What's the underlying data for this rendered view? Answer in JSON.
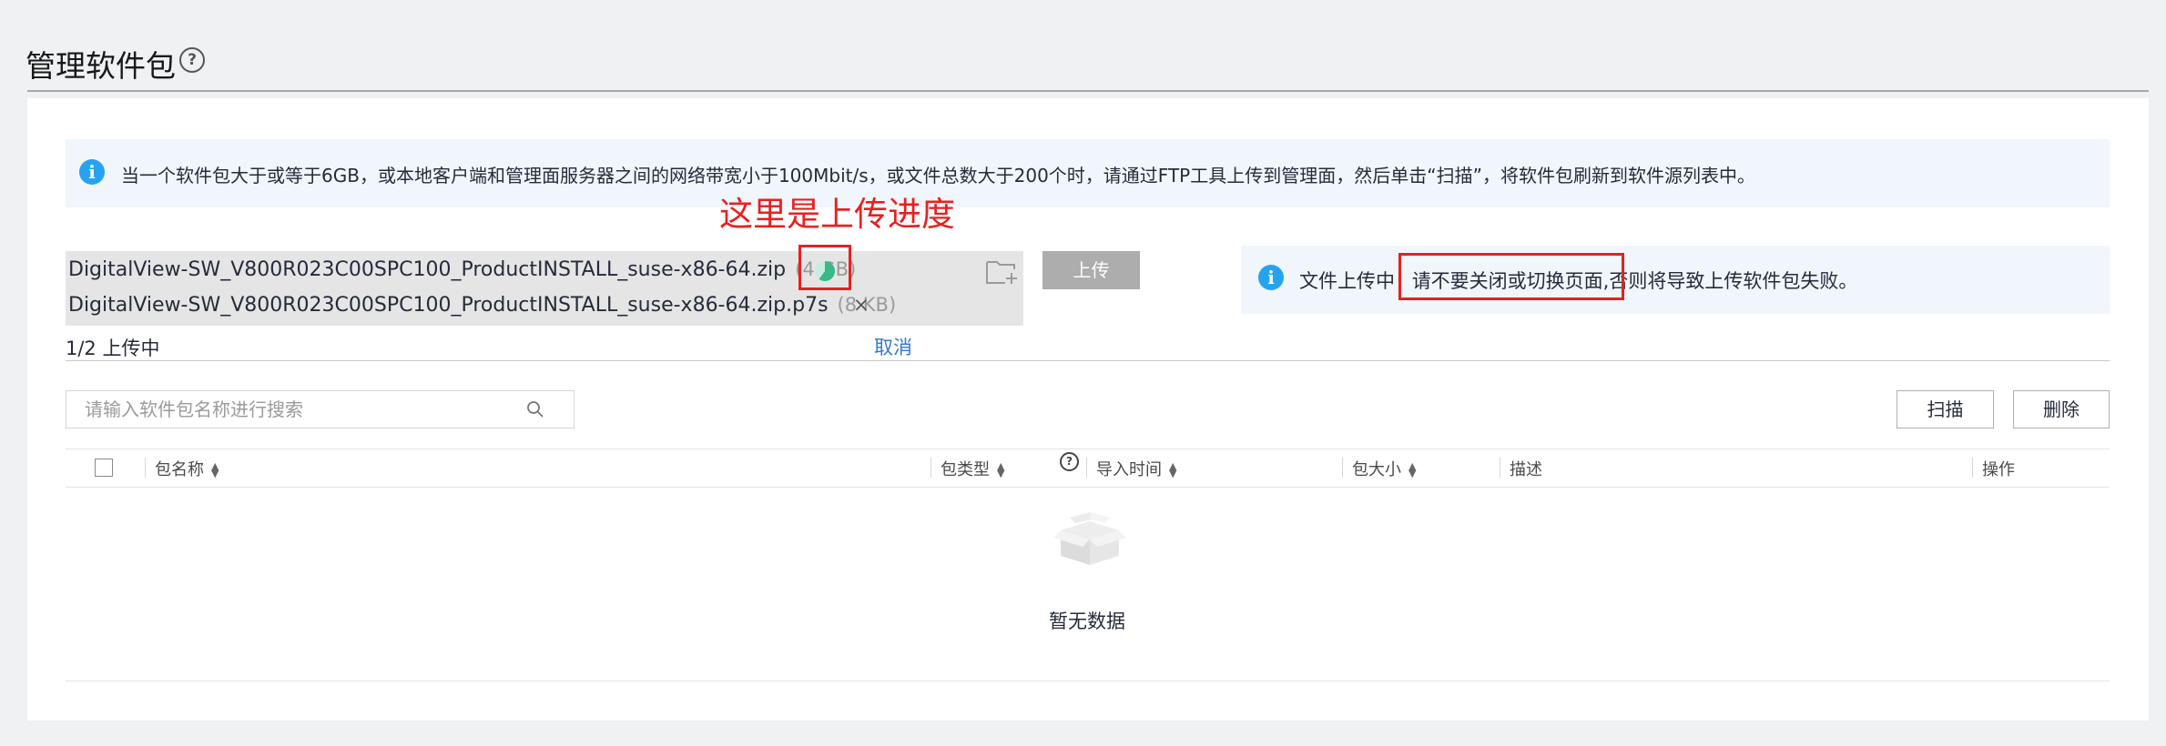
{
  "page": {
    "title": "管理软件包"
  },
  "info_banner": {
    "text": "当一个软件包大于或等于6GB，或本地客户端和管理面服务器之间的网络带宽小于100Mbit/s，或文件总数大于200个时，请通过FTP工具上传到管理面，然后单击“扫描”，将软件包刷新到软件源列表中。"
  },
  "annotation": {
    "callout": "这里是上传进度"
  },
  "upload": {
    "files": [
      {
        "name": "DigitalView-SW_V800R023C00SPC100_ProductINSTALL_suse-x86-64.zip",
        "size": "(4 GB)"
      },
      {
        "name": "DigitalView-SW_V800R023C00SPC100_ProductINSTALL_suse-x86-64.zip.p7s",
        "size": "(8 KB)"
      }
    ],
    "remove_symbol": "×",
    "button_label": "上传",
    "status": "1/2 上传中",
    "cancel_label": "取消"
  },
  "upload_notice": {
    "lead": "文件上传中",
    "highlight": "请不要关闭或切换页面,",
    "rest": "否则将导致上传软件包失败。"
  },
  "search": {
    "placeholder": "请输入软件包名称进行搜索",
    "value": ""
  },
  "toolbar": {
    "scan_label": "扫描",
    "delete_label": "删除"
  },
  "table": {
    "columns": [
      {
        "label": "包名称",
        "sortable": true
      },
      {
        "label": "包类型",
        "sortable": true
      },
      {
        "label": "导入时间",
        "sortable": true
      },
      {
        "label": "包大小",
        "sortable": true
      },
      {
        "label": "描述",
        "sortable": false
      },
      {
        "label": "操作",
        "sortable": false
      }
    ],
    "empty_text": "暂无数据"
  },
  "colors": {
    "accent_blue": "#26a3f0",
    "link_blue": "#2f7ad0",
    "annotation_red": "#e6211f",
    "progress_green": "#3ab885"
  }
}
